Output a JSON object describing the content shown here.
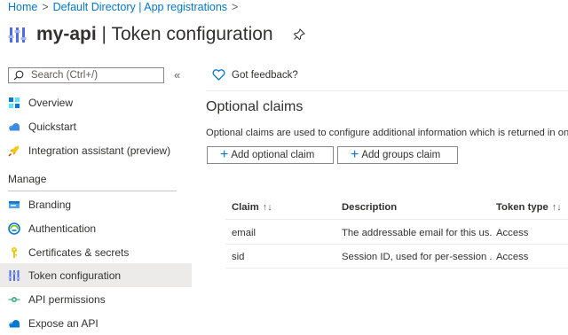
{
  "breadcrumb": {
    "items": [
      "Home",
      "Default Directory | App registrations"
    ],
    "sep": ">"
  },
  "header": {
    "app_name": "my-api",
    "separator": "|",
    "page": "Token configuration"
  },
  "sidebar": {
    "search_placeholder": "Search (Ctrl+/)",
    "collapse_glyph": "«",
    "items_top": [
      {
        "label": "Overview",
        "icon": "overview-icon"
      },
      {
        "label": "Quickstart",
        "icon": "quickstart-cloud-icon"
      },
      {
        "label": "Integration assistant (preview)",
        "icon": "rocket-icon"
      }
    ],
    "section": "Manage",
    "items_manage": [
      {
        "label": "Branding",
        "icon": "branding-icon"
      },
      {
        "label": "Authentication",
        "icon": "authentication-icon"
      },
      {
        "label": "Certificates & secrets",
        "icon": "key-icon"
      },
      {
        "label": "Token configuration",
        "icon": "token-config-icon",
        "active": true
      },
      {
        "label": "API permissions",
        "icon": "api-permissions-icon"
      },
      {
        "label": "Expose an API",
        "icon": "expose-api-cloud-icon"
      }
    ]
  },
  "main": {
    "feedback": "Got feedback?",
    "heading": "Optional claims",
    "description": "Optional claims are used to configure additional information which is returned in one",
    "buttons": {
      "add_optional": "Add optional claim",
      "add_groups": "Add groups claim"
    },
    "table": {
      "columns": {
        "claim": "Claim",
        "description": "Description",
        "token_type": "Token type"
      },
      "sort_glyph": "↑↓",
      "rows": [
        {
          "claim": "email",
          "description": "The addressable email for this us...",
          "token_type": "Access"
        },
        {
          "claim": "sid",
          "description": "Session ID, used for per-session ...",
          "token_type": "Access"
        }
      ]
    }
  },
  "colors": {
    "accent": "#0078d4",
    "active_bg": "#edebe9",
    "text": "#323130"
  }
}
